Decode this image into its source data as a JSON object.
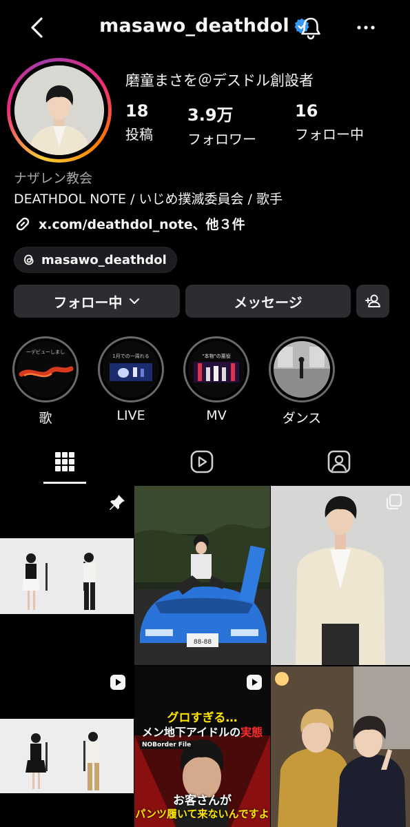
{
  "header": {
    "username": "masawo_deathdol",
    "verified": true
  },
  "profile": {
    "display_name": "磨童まさを＠デスドル創設者",
    "stats": [
      {
        "value": "18",
        "label": "投稿"
      },
      {
        "value": "3.9万",
        "label": "フォロワー"
      },
      {
        "value": "16",
        "label": "フォロー中"
      }
    ],
    "category": "ナザレン教会",
    "bio": "DEATHDOL NOTE / いじめ撲滅委員会 / 歌手",
    "link": "x.com/deathdol_note、他３件",
    "threads_handle": "masawo_deathdol"
  },
  "actions": {
    "follow_label": "フォロー中",
    "message_label": "メッセージ"
  },
  "highlights": [
    {
      "label": "歌",
      "cover_text": "ーデビューしまし"
    },
    {
      "label": "LIVE",
      "cover_text": "1月での一周れる"
    },
    {
      "label": "MV",
      "cover_text": "\"本物\"の悪役"
    },
    {
      "label": "ダンス",
      "cover_text": ""
    }
  ],
  "posts": {
    "post5": {
      "headline": "グロすぎる…",
      "subline_pre": "メン地下アイドルの",
      "subline_red": "実態",
      "brand": "NOBorder File",
      "caption_top": "お客さんが",
      "caption_bottom": "パンツ履いて来ないんですよ"
    },
    "car_plate": "88-88"
  },
  "colors": {
    "background": "#000000",
    "button_bg": "#2c2d31",
    "verified_blue": "#3897f0",
    "secondary_text": "#a8a8a8"
  }
}
